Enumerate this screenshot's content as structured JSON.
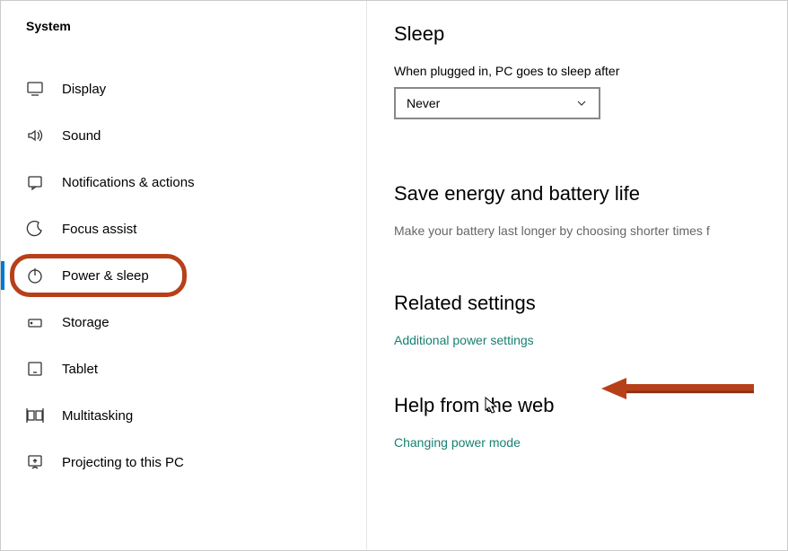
{
  "sidebar": {
    "title": "System",
    "items": [
      {
        "label": "Display",
        "icon": "display-icon"
      },
      {
        "label": "Sound",
        "icon": "sound-icon"
      },
      {
        "label": "Notifications & actions",
        "icon": "notifications-icon"
      },
      {
        "label": "Focus assist",
        "icon": "focus-icon"
      },
      {
        "label": "Power & sleep",
        "icon": "power-icon"
      },
      {
        "label": "Storage",
        "icon": "storage-icon"
      },
      {
        "label": "Tablet",
        "icon": "tablet-icon"
      },
      {
        "label": "Multitasking",
        "icon": "multitasking-icon"
      },
      {
        "label": "Projecting to this PC",
        "icon": "projecting-icon"
      }
    ]
  },
  "content": {
    "sleep": {
      "title": "Sleep",
      "plugged_label": "When plugged in, PC goes to sleep after",
      "plugged_value": "Never"
    },
    "energy": {
      "title": "Save energy and battery life",
      "desc": "Make your battery last longer by choosing shorter times f"
    },
    "related": {
      "title": "Related settings",
      "link": "Additional power settings"
    },
    "help": {
      "title": "Help from the web",
      "link": "Changing power mode"
    }
  },
  "annotations": {
    "highlighted_sidebar_item": "Power & sleep",
    "arrow_target": "Additional power settings",
    "arrow_color": "#b74019"
  }
}
